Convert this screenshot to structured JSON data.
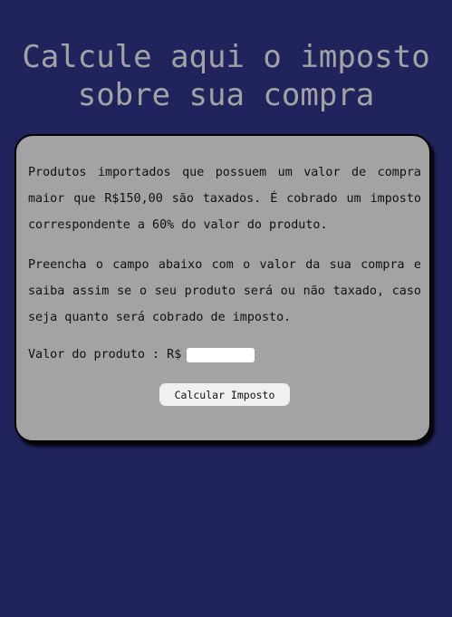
{
  "header": {
    "title_line1": "Calcule aqui o imposto",
    "title_line2": "sobre sua compra"
  },
  "card": {
    "paragraph1": "Produtos importados que possuem um valor de compra maior que R$150,00 são taxados. É cobrado um imposto correspondente a 60% do valor do produto.",
    "paragraph2": "Preencha o campo abaixo com o valor da sua compra e saiba assim se o seu produto será ou não taxado, caso seja quanto será cobrado de imposto.",
    "value_label": "Valor do produto : R$",
    "value_input": {
      "value": "",
      "placeholder": ""
    },
    "button_label": "Calcular Imposto"
  },
  "colors": {
    "background": "#21235c",
    "card": "#a3a3a3",
    "title": "#a3a3a3",
    "button": "#f0f0f0"
  }
}
